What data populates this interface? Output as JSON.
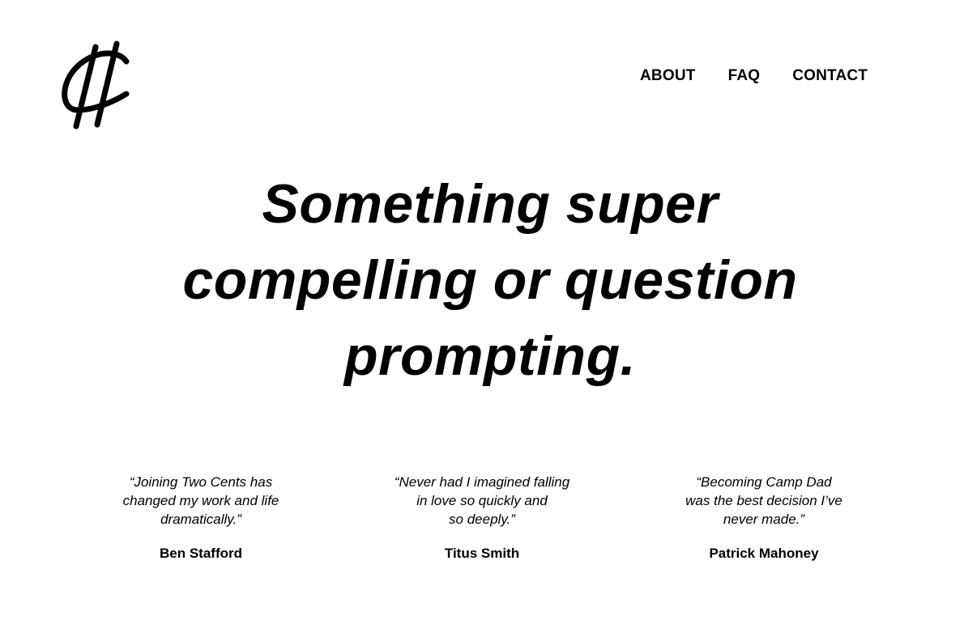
{
  "logo": {
    "icon": "cent-sign-logo",
    "alt": "Two Cents"
  },
  "nav": {
    "items": [
      {
        "label": "ABOUT"
      },
      {
        "label": "FAQ"
      },
      {
        "label": "CONTACT"
      }
    ]
  },
  "hero": {
    "headline": "Something super compelling or question prompting."
  },
  "testimonials": [
    {
      "quote": "“Joining Two Cents has\nchanged my work and life\ndramatically.”",
      "author": "Ben Stafford"
    },
    {
      "quote": "“Never had I imagined falling\nin love so quickly and\nso deeply.”",
      "author": "Titus Smith"
    },
    {
      "quote": "“Becoming Camp Dad\nwas the best decision I’ve\nnever made.”",
      "author": "Patrick Mahoney"
    }
  ],
  "colors": {
    "background": "#ffffff",
    "text": "#000000"
  }
}
